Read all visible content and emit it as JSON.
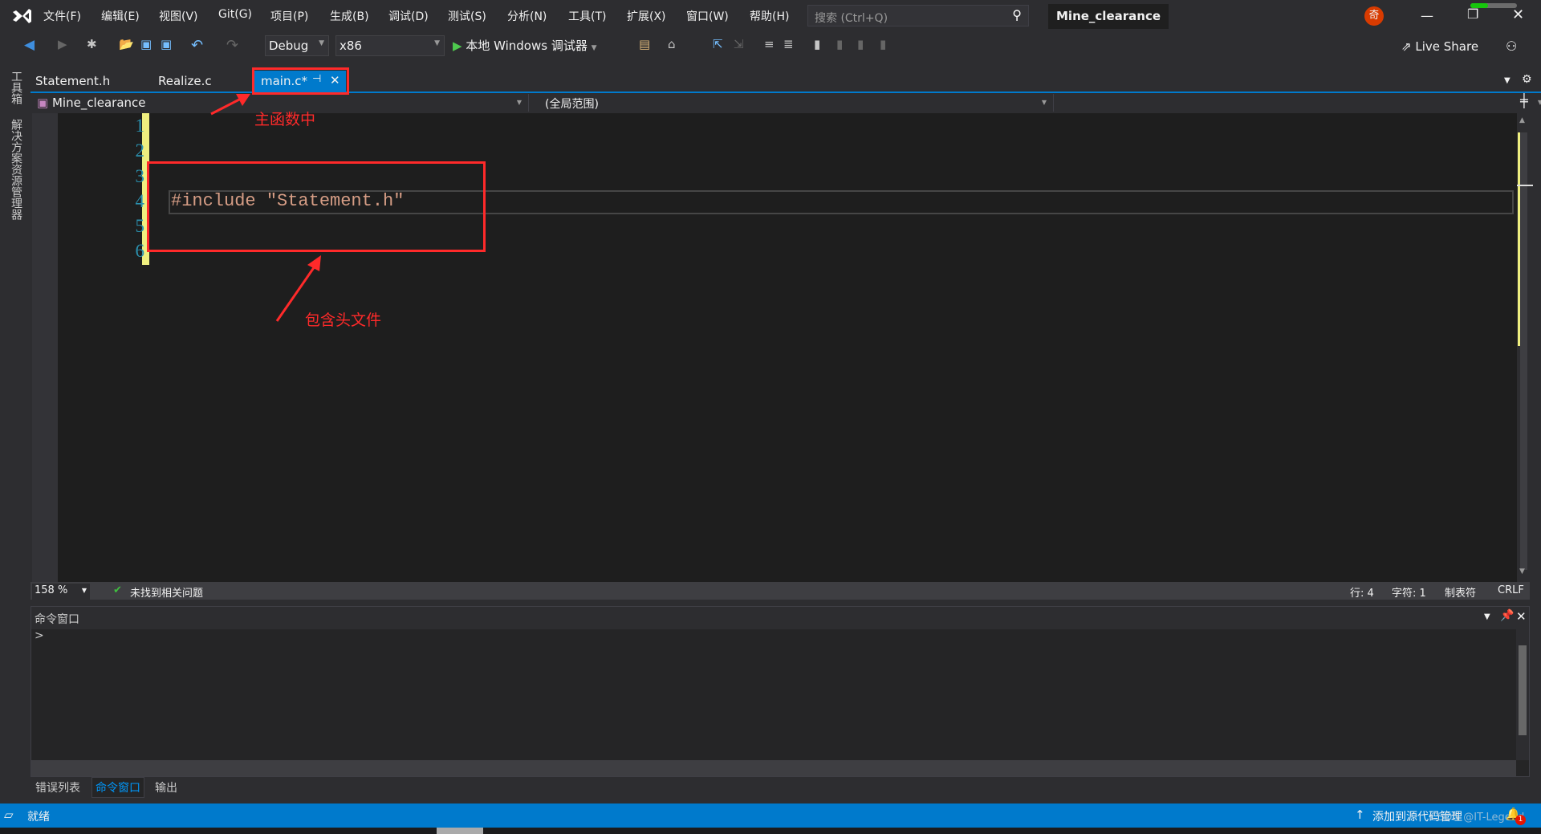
{
  "title_bar": {
    "menu": [
      "文件(F)",
      "编辑(E)",
      "视图(V)",
      "Git(G)",
      "项目(P)",
      "生成(B)",
      "调试(D)",
      "测试(S)",
      "分析(N)",
      "工具(T)",
      "扩展(X)",
      "窗口(W)",
      "帮助(H)"
    ],
    "search_placeholder": "搜索 (Ctrl+Q)",
    "solution_name": "Mine_clearance",
    "avatar_letter": "奇"
  },
  "toolbar": {
    "config": "Debug",
    "platform": "x86",
    "run_label": "本地 Windows 调试器",
    "live_share": "Live Share"
  },
  "side_panel": {
    "toolbox": "工具箱",
    "solution_explorer": "解决方案资源管理器"
  },
  "tabs": [
    {
      "label": "Statement.h",
      "active": false
    },
    {
      "label": "Realize.c",
      "active": false
    },
    {
      "label": "main.c*",
      "active": true
    }
  ],
  "nav_bar": {
    "project": "Mine_clearance",
    "scope": "(全局范围)"
  },
  "editor": {
    "line_numbers": [
      "1",
      "2",
      "3",
      "4",
      "5",
      "6"
    ],
    "code_line_4": "#include \"Statement.h\"",
    "current_line": 4
  },
  "annotations": {
    "tab_note": "主函数中",
    "include_note": "包含头文件",
    "color": "#ff2a2a"
  },
  "editor_status": {
    "zoom": "158 %",
    "issues": "未找到相关问题",
    "line": "行: 4",
    "char": "字符: 1",
    "indent": "制表符",
    "eol": "CRLF"
  },
  "command_window": {
    "title": "命令窗口",
    "prompt": ">"
  },
  "bottom_tabs": [
    {
      "label": "错误列表",
      "active": false
    },
    {
      "label": "命令窗口",
      "active": true
    },
    {
      "label": "输出",
      "active": false
    }
  ],
  "status_bar": {
    "ready": "就绪",
    "source_control": "添加到源代码管理",
    "notifications": "1",
    "watermark": "CSDN @IT-Legend"
  },
  "colors": {
    "accent": "#007acc",
    "background": "#1e1e1e",
    "line_number": "#2b91af",
    "change_bar": "#efef7f"
  }
}
